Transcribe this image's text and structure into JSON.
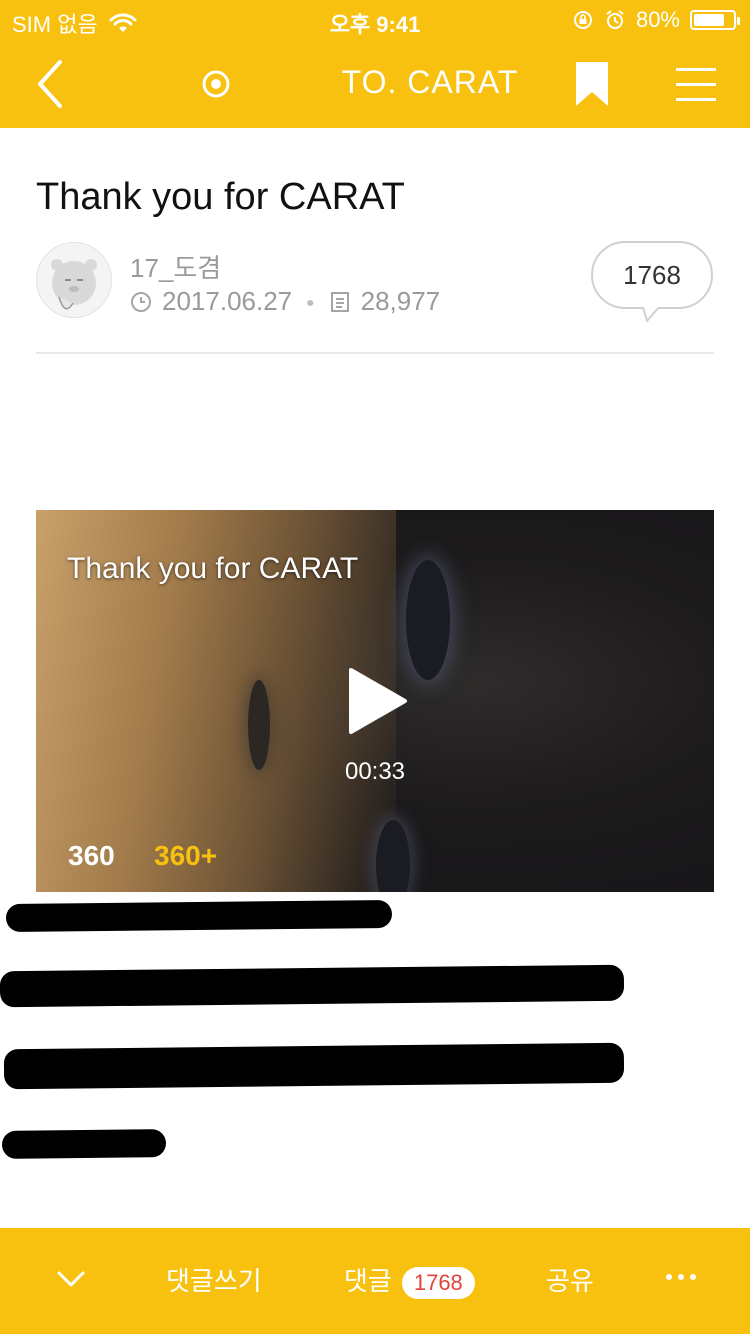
{
  "status_bar": {
    "carrier": "SIM 없음",
    "time": "오후 9:41",
    "battery_percent": "80%",
    "battery_level": 0.8
  },
  "nav": {
    "title": "TO. CARAT",
    "back_icon": "chevron-left-icon",
    "target_icon": "radio-target-icon",
    "bookmark_icon": "bookmark-icon",
    "menu_icon": "hamburger-menu-icon"
  },
  "post": {
    "title": "Thank you for CARAT",
    "author": "17_도겸",
    "date": "2017.06.27",
    "views": "28,977",
    "comment_count": "1768"
  },
  "video": {
    "title": "Thank you for CARAT",
    "duration": "00:33",
    "quality_label": "360",
    "quality_plus_label": "360+"
  },
  "bottom_bar": {
    "write_comment": "댓글쓰기",
    "comments_label": "댓글",
    "comments_count": "1768",
    "share": "공유"
  },
  "colors": {
    "brand_yellow": "#f8c10f",
    "badge_red": "#e0443a"
  }
}
